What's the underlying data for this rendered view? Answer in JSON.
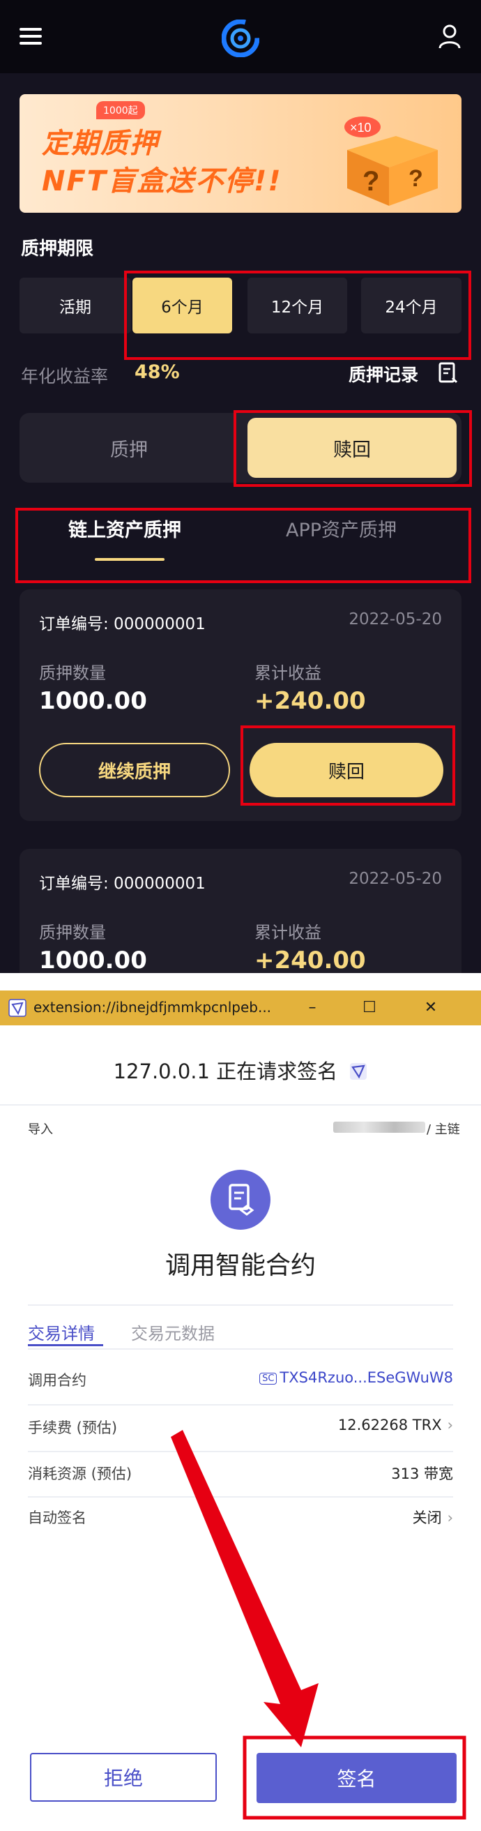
{
  "app": {
    "banner": {
      "tag": "1000起",
      "line1": "定期质押",
      "line2": "NFT盲盒送不停!!",
      "multiplier": "×10"
    },
    "period_title": "质押期限",
    "periods": [
      "活期",
      "6个月",
      "12个月",
      "24个月"
    ],
    "selected_period": "6个月",
    "rate_label": "年化收益率",
    "rate_value": "48%",
    "record_link": "质押记录",
    "segments": [
      "质押",
      "赎回"
    ],
    "selected_segment": "赎回",
    "tabs": [
      "链上资产质押",
      "APP资产质押"
    ],
    "selected_tab": "链上资产质押",
    "orders": [
      {
        "order_label": "订单编号: 000000001",
        "date": "2022-05-20",
        "qty_label": "质押数量",
        "qty": "1000.00",
        "earn_label": "累计收益",
        "earn": "+240.00",
        "btn_continue": "继续质押",
        "btn_redeem": "赎回"
      },
      {
        "order_label": "订单编号: 000000001",
        "date": "2022-05-20",
        "qty_label": "质押数量",
        "qty": "1000.00",
        "earn_label": "累计收益",
        "earn": "+240.00"
      }
    ],
    "colors": {
      "accent": "#f7d880",
      "background": "#151320",
      "highlight_box": "#e60012"
    }
  },
  "popup": {
    "window_title": "extension://ibnejdfjmmkpcnlpeb...",
    "window_controls": [
      "–",
      "☐",
      "✕"
    ],
    "request_title": "127.0.0.1 正在请求签名",
    "import_label": "导入",
    "network": "/ 主链",
    "contract_title": "调用智能合约",
    "detail_tabs": [
      "交易详情",
      "交易元数据"
    ],
    "rows": [
      {
        "label": "调用合约",
        "badge": "SC",
        "value": "TXS4Rzuo...ESeGWuW8"
      },
      {
        "label": "手续费 (预估)",
        "value": "12.62268 TRX"
      },
      {
        "label": "消耗资源 (预估)",
        "value": "313 带宽"
      },
      {
        "label": "自动签名",
        "value": "关闭"
      }
    ],
    "reject_label": "拒绝",
    "sign_label": "签名",
    "colors": {
      "primary": "#5a5fd0",
      "titlebar": "#e3b23c"
    }
  }
}
